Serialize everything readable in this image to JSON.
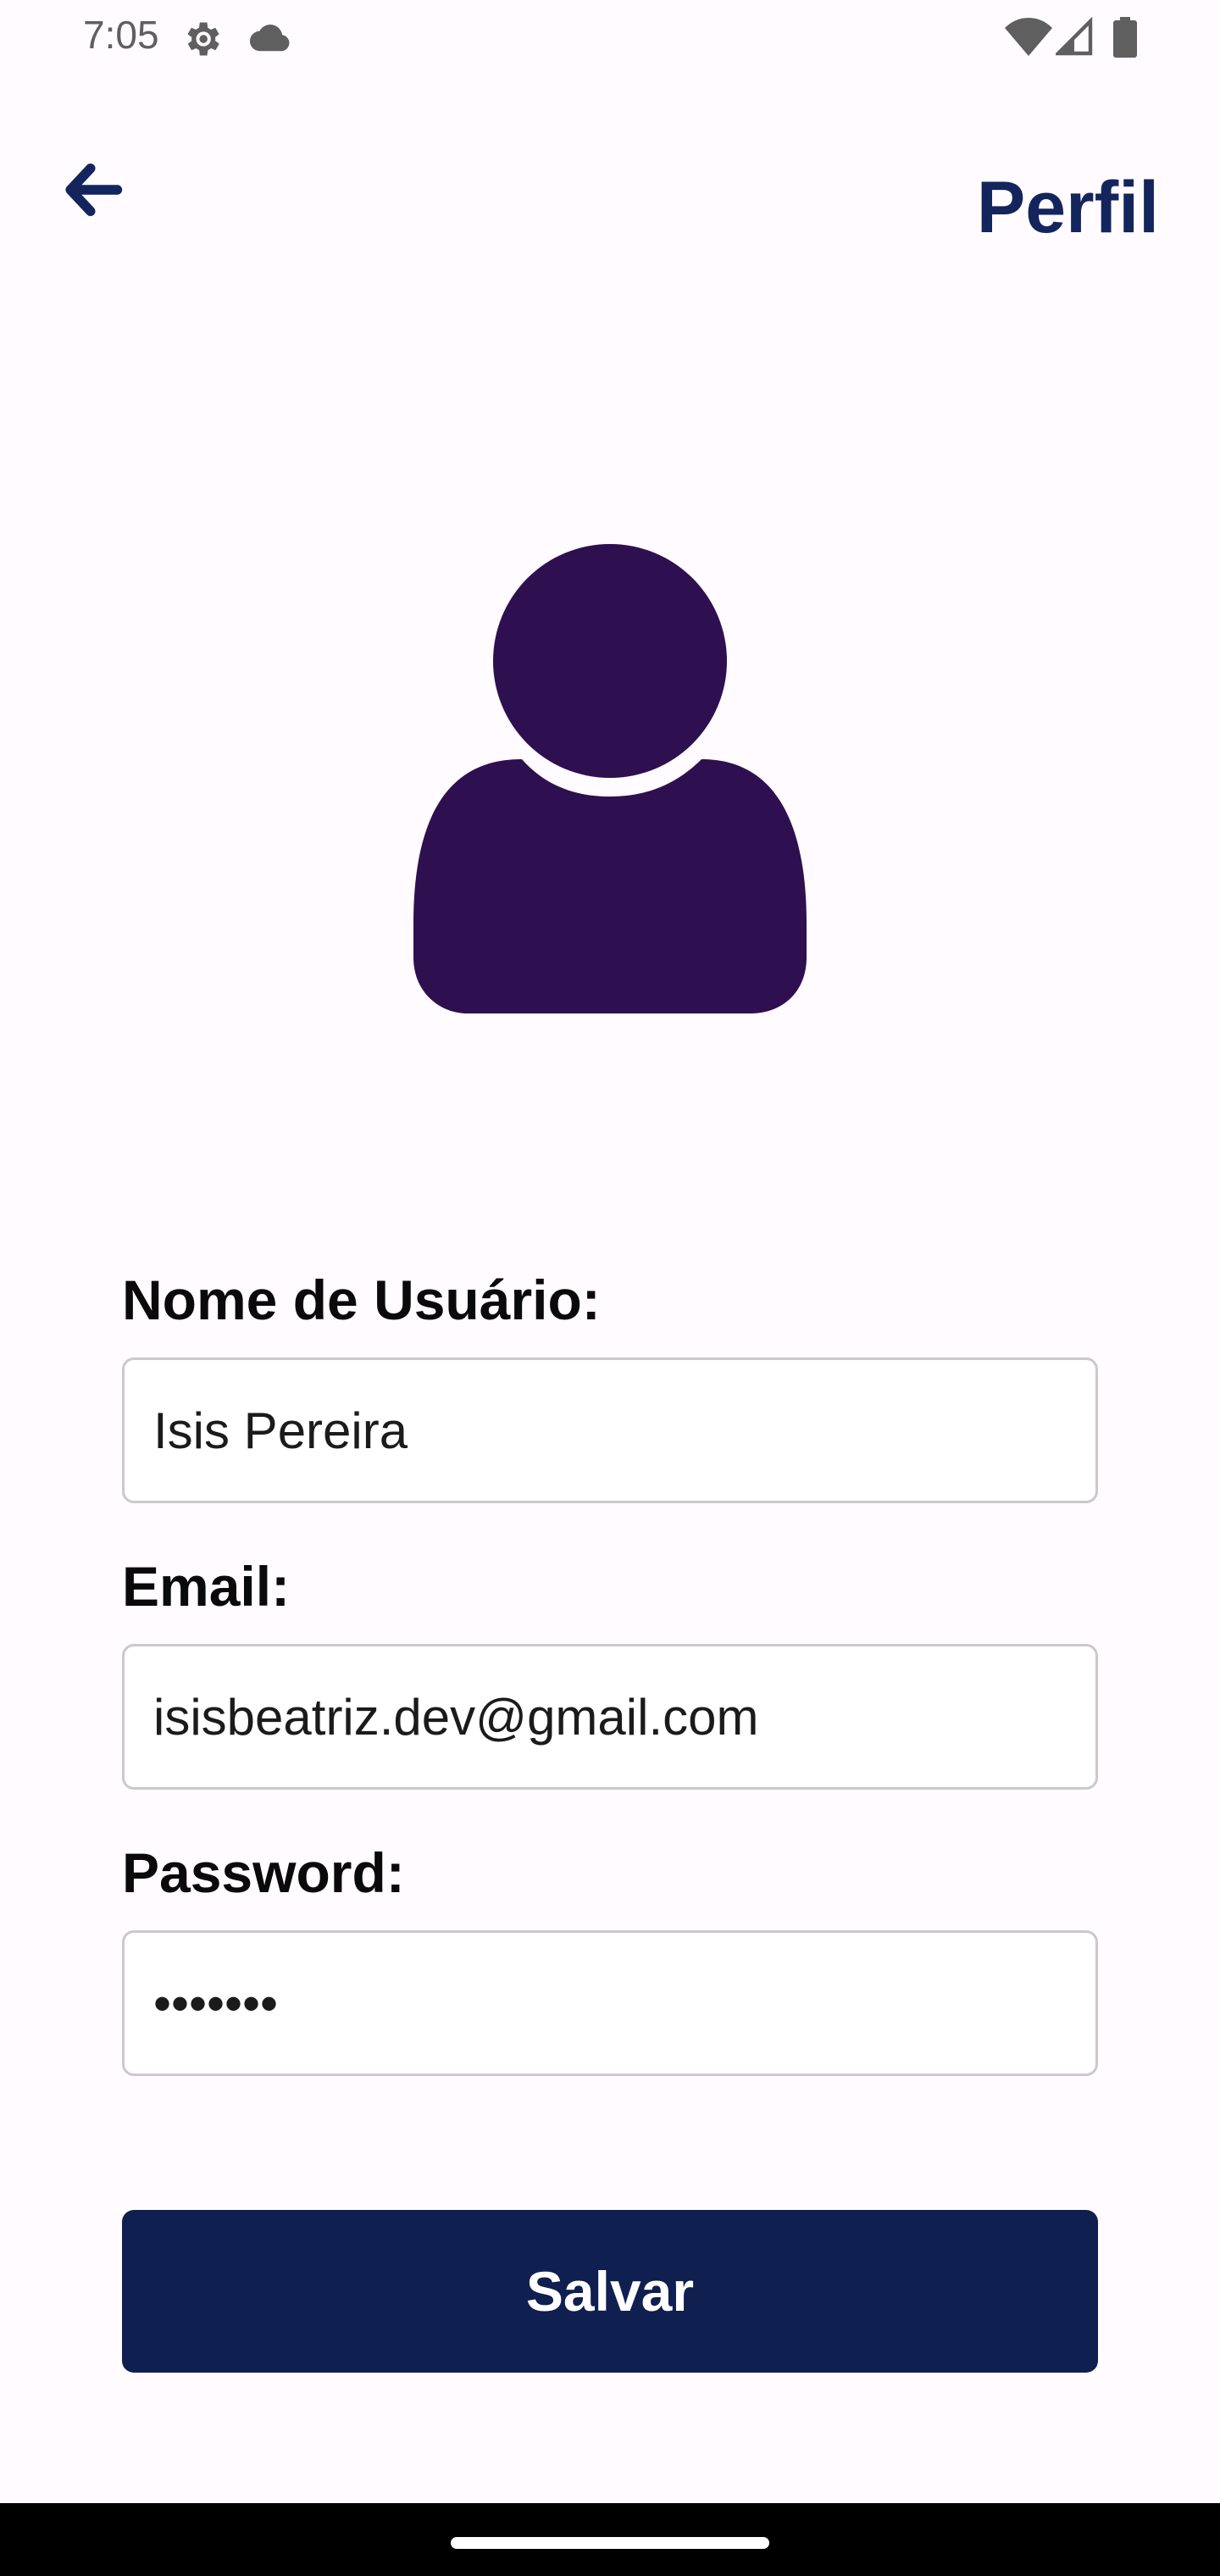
{
  "status_bar": {
    "time": "7:05",
    "icons": [
      "gear-icon",
      "cloud-icon",
      "wifi-icon",
      "signal-icon",
      "battery-icon"
    ]
  },
  "app_bar": {
    "back_icon": "arrow-left-icon",
    "title": "Perfil"
  },
  "avatar": {
    "icon": "user-icon",
    "color": "#2e1050"
  },
  "form": {
    "username": {
      "label": "Nome de Usuário:",
      "value": "Isis Pereira"
    },
    "email": {
      "label": "Email:",
      "value": "isisbeatriz.dev@gmail.com"
    },
    "password": {
      "label": "Password:",
      "value": "•••••••"
    },
    "save_label": "Salvar"
  },
  "colors": {
    "primary": "#0f1f4f",
    "title": "#13255c",
    "avatar": "#2e1050",
    "background": "#fffbff"
  }
}
